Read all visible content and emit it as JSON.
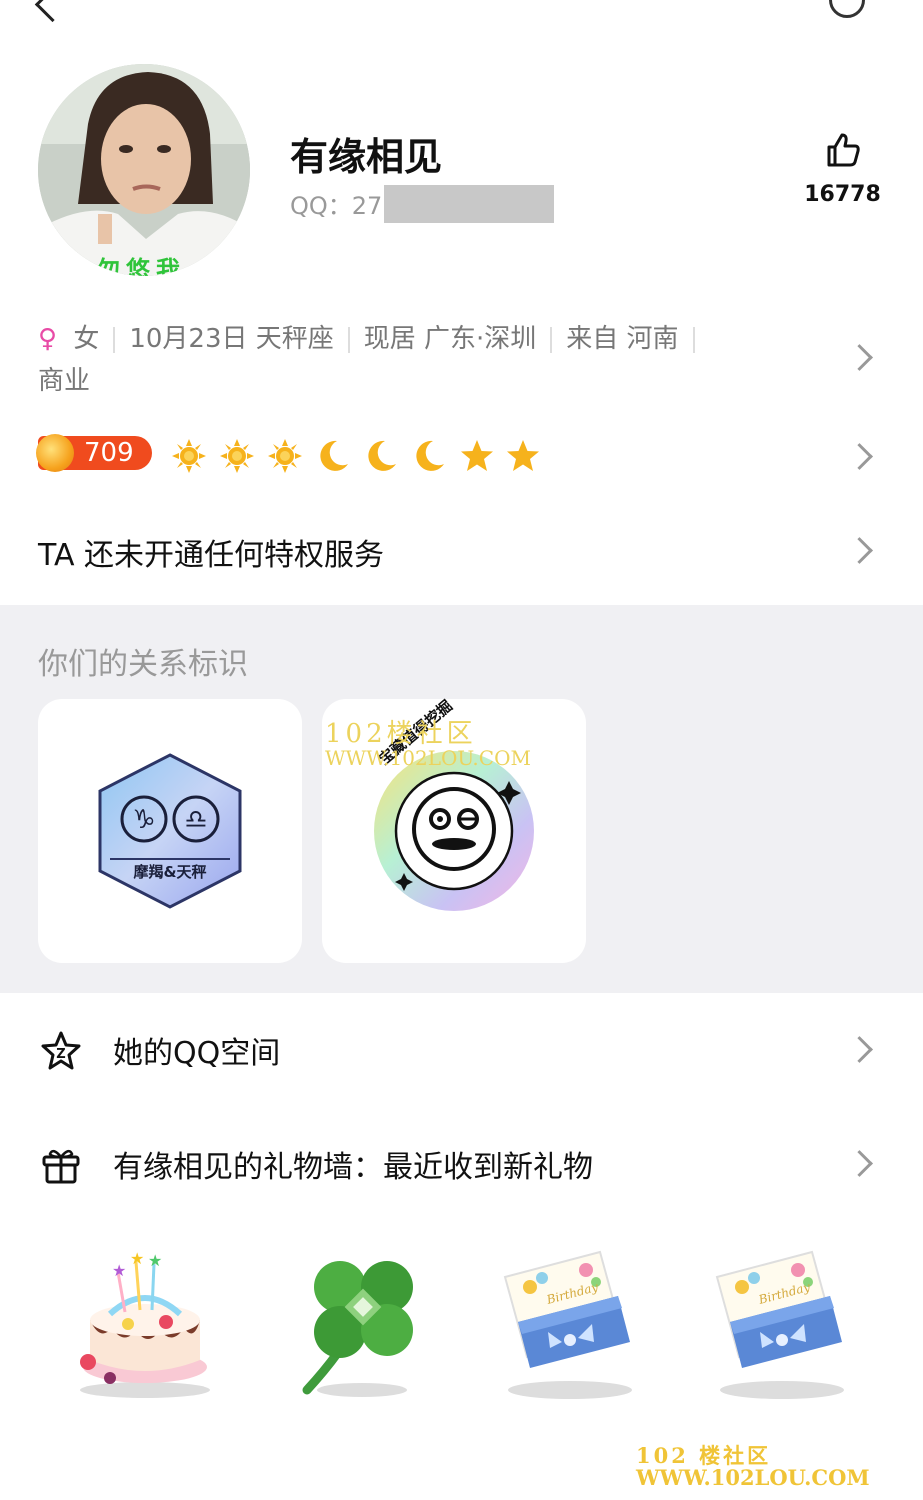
{
  "profile": {
    "name": "有缘相见",
    "qq_label": "QQ：",
    "qq_prefix": "27",
    "likes": "16778",
    "avatar_caption": "勿悠我"
  },
  "info": {
    "gender_symbol": "♀",
    "gender": "女",
    "birthday": "10月23日 天秤座",
    "residence": "现居 广东·深圳",
    "hometown": "来自 河南",
    "industry": "商业"
  },
  "level": {
    "value": "709",
    "icons": [
      "sun-icon",
      "sun-icon",
      "sun-icon",
      "moon-icon",
      "moon-icon",
      "moon-icon",
      "star-icon",
      "star-icon"
    ]
  },
  "privilege_text": "TA 还未开通任何特权服务",
  "relationship": {
    "heading": "你们的关系标识",
    "badges": [
      {
        "icon": "zodiac-badge-icon",
        "label": "摩羯&天秤"
      },
      {
        "icon": "treasure-badge-icon",
        "label": "宝藏值得挖掘"
      }
    ]
  },
  "menu": {
    "qzone_label": "她的QQ空间",
    "gift_wall_label": "有缘相见的礼物墙：最近收到新礼物"
  },
  "gifts": [
    "birthday-cake-icon",
    "four-leaf-clover-icon",
    "birthday-card-icon",
    "birthday-card-icon"
  ],
  "watermark": {
    "line1": "102楼社区",
    "line2": "WWW.102LOU.COM",
    "bottom_line1": "102 楼社区",
    "bottom_line2": "WWW.102LOU.COM"
  },
  "colors": {
    "accent_female": "#e84ba6",
    "level_badge": "#f04b1e",
    "section_bg": "#f0f0f3"
  }
}
